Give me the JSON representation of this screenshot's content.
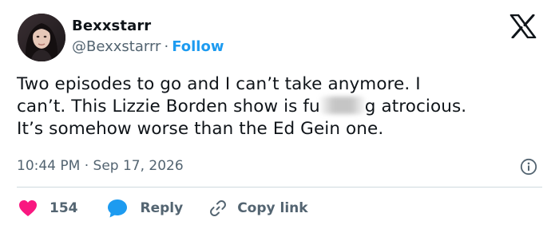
{
  "author": {
    "display_name": "Bexxstarr",
    "handle": "@Bexxstarrr",
    "separator": "·",
    "follow_label": "Follow"
  },
  "tweet": {
    "text_before_censor": "Two episodes to go and I can’t take anymore. I\ncan’t. This Lizzie Borden show is fu",
    "text_after_censor": "g atrocious.\nIt’s somehow worse than the Ed Gein one.",
    "timestamp": "10:44 PM · Sep 17, 2026"
  },
  "actions": {
    "like_count": "154",
    "reply_label": "Reply",
    "copy_link_label": "Copy link"
  },
  "icons": {
    "brand": "x-logo-icon",
    "info": "info-icon",
    "like": "heart-icon",
    "reply": "chat-bubble-icon",
    "copy": "link-icon"
  },
  "colors": {
    "text": "#0f1419",
    "secondary": "#536471",
    "accent": "#1d9bf0",
    "like": "#f91880",
    "divider": "#cfd9de"
  }
}
